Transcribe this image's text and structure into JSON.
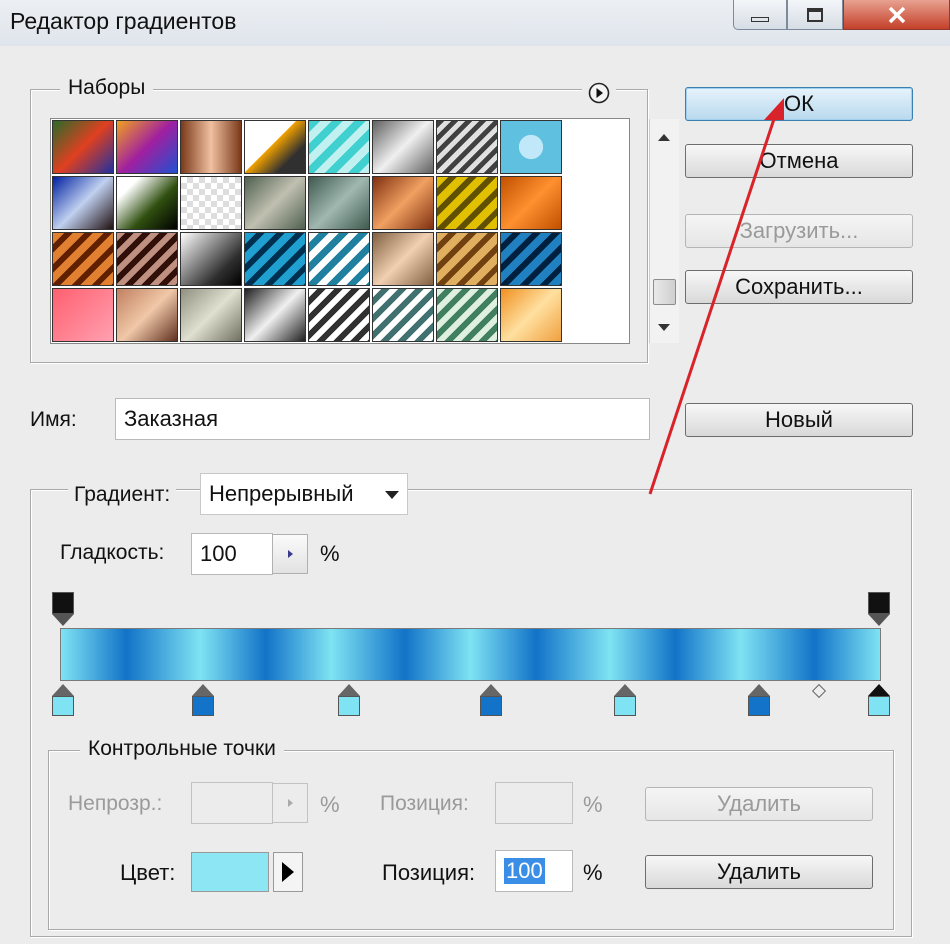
{
  "window": {
    "title": "Редактор градиентов",
    "min_icon": "minimize-icon",
    "max_icon": "maximize-icon",
    "close_icon": "close-icon"
  },
  "presets": {
    "legend": "Наборы",
    "menu_icon": "circle-play-icon",
    "swatch_count": 32,
    "scroll_up_icon": "arrow-up-icon",
    "scroll_down_icon": "arrow-down-icon"
  },
  "buttons": {
    "ok": "ОК",
    "cancel": "Отмена",
    "load": "Загрузить...",
    "save": "Сохранить...",
    "new": "Новый"
  },
  "name": {
    "label": "Имя:",
    "value": "Заказная"
  },
  "gradient": {
    "type_label": "Градиент:",
    "type_value": "Непрерывный",
    "smoothness_label": "Гладкость:",
    "smoothness_value": "100",
    "smoothness_unit": "%",
    "colors": {
      "light": "#7fe3f3",
      "dark": "#1273c8"
    }
  },
  "stops": {
    "legend": "Контрольные точки",
    "opacity_label": "Непрозр.:",
    "opacity_value": "",
    "opacity_unit": "%",
    "opacity_position_label": "Позиция:",
    "opacity_position_value": "",
    "opacity_position_unit": "%",
    "opacity_delete": "Удалить",
    "color_label": "Цвет:",
    "color_value": "#8ce6f3",
    "color_position_label": "Позиция:",
    "color_position_value": "100",
    "color_position_unit": "%",
    "color_delete": "Удалить"
  }
}
